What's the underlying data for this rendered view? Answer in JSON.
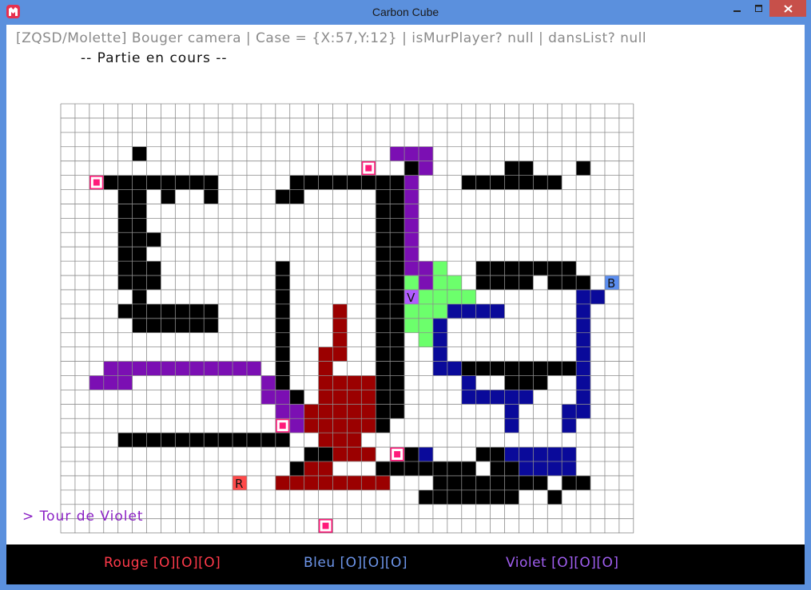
{
  "window": {
    "title": "Carbon Cube",
    "icon": "game-logo-icon"
  },
  "hud": {
    "status_line": "[ZQSD/Molette] Bouger camera | Case = {X:57,Y:12} | isMurPlayer? null | dansList? null",
    "game_state": "-- Partie en cours --",
    "turn": "> Tour de Violet"
  },
  "scoreboard": {
    "rouge": "Rouge [O][O][O]",
    "bleu": "Bleu [O][O][O]",
    "violet": "Violet [O][O][O]"
  },
  "colors": {
    "wall": "#000000",
    "violet_trail": "#7b0fb3",
    "red_trail": "#9b0000",
    "blue_trail": "#0a0a9a",
    "green_zone": "#6cff6c",
    "grid_line": "#8c8c8c",
    "bonus": "#ff1a7a"
  },
  "board": {
    "cols": 40,
    "rows": 30,
    "grid": [
      "........................................",
      "........................................",
      "........................................",
      ".....#.................VVV..............",
      "........................#V.....##...#...",
      "...########.....########V...#######.....",
      "....##.#..#....##.....##V...............",
      "....##................##V...............",
      "....##................##V...............",
      "....###...............##V...............",
      "....##................##V...............",
      "....###........#......##VVG..#######....",
      "....###........#......##GVGG.####.###B..",
      ".....#.........#......##GGGGG.......bb..",
      "....#######....#...R..##GGGbbbb.....b...",
      ".....######....#...R..##GGb.........b...",
      "...............#...R..##.Gb.........b...",
      "...............#..RR..##..b.........b...",
      "...VVVVVVVVVVV.#..R...##..bb########b...",
      "..VVV.........V#..RRRR##....b..###..b...",
      "..............VV#.RRRR##....bbbbb...b...",
      "...............VVRRRRR##.......b...bb...",
      "................VRRRRR#........b...b....",
      "....############..RRR.................",
      ".................##RRR.##b...##bbbbb...",
      "................#RR...#######.##bbbb....",
      "...............RRRRRRRR...########.##.....",
      ".........................#######..#......",
      "........................................",
      "........................................"
    ],
    "player_markers": [
      {
        "label": "V",
        "col": 24,
        "row": 13,
        "player": "violet",
        "color": "#b05cff"
      },
      {
        "label": "B",
        "col": 38,
        "row": 12,
        "player": "bleu",
        "color": "#5b8ef0"
      },
      {
        "label": "R",
        "col": 12,
        "row": 26,
        "player": "rouge",
        "color": "#ff4a4a"
      }
    ],
    "bonus_cells": [
      {
        "col": 2,
        "row": 5
      },
      {
        "col": 21,
        "row": 4
      },
      {
        "col": 15,
        "row": 22
      },
      {
        "col": 23,
        "row": 24
      },
      {
        "col": 18,
        "row": 29
      }
    ]
  }
}
